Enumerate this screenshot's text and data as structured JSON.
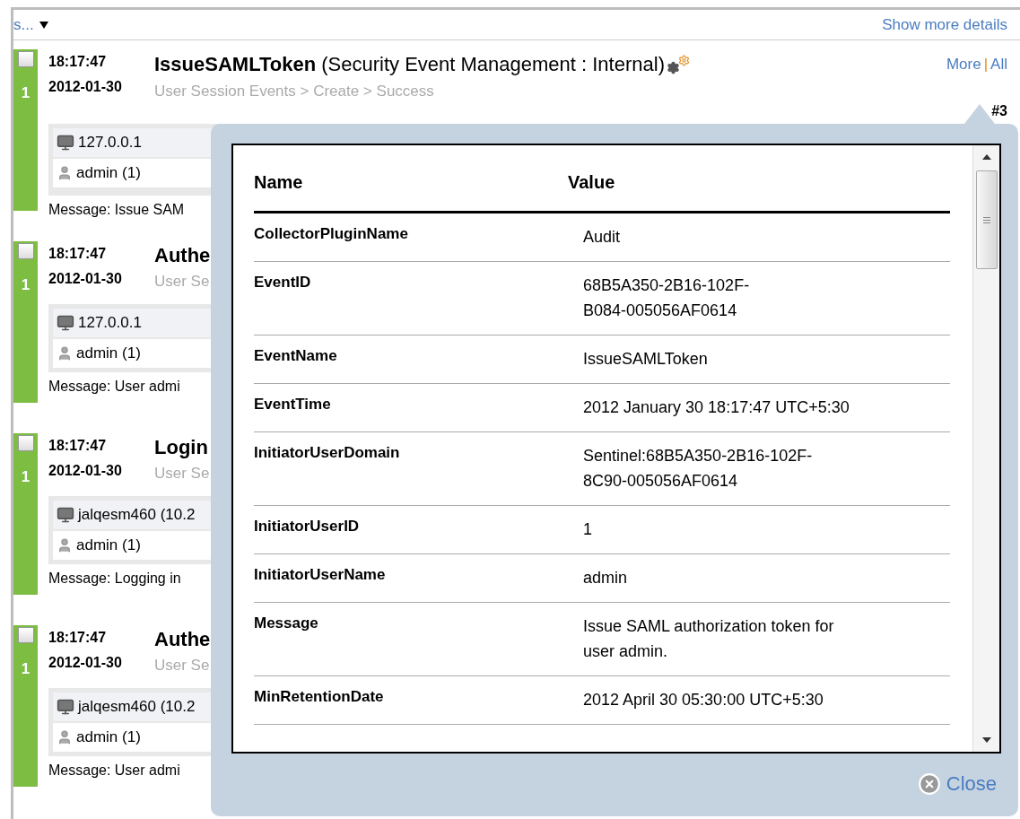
{
  "toolbar": {
    "filter_link": "s...",
    "show_more": "Show more details"
  },
  "events": [
    {
      "checked": false,
      "count": "1",
      "time": "18:17:47",
      "date": "2012-01-30",
      "title": "IssueSAMLToken",
      "source": "(Security Event Management : Internal)",
      "category": "User Session Events > Create > Success",
      "source_host": "127.0.0.1",
      "user": "admin (1)",
      "message": "Message: Issue SAM",
      "more": "More",
      "separator": "|",
      "all": "All",
      "number": "#3"
    },
    {
      "checked": false,
      "count": "1",
      "time": "18:17:47",
      "date": "2012-01-30",
      "title": "Authe",
      "category": "User Se",
      "source_host": "127.0.0.1",
      "user": "admin (1)",
      "message": "Message: User admi"
    },
    {
      "checked": false,
      "count": "1",
      "time": "18:17:47",
      "date": "2012-01-30",
      "title": "Login",
      "category": "User Se",
      "source_host": "jalqesm460 (10.2",
      "user": "admin (1)",
      "message": "Message: Logging in"
    },
    {
      "checked": false,
      "count": "1",
      "time": "18:17:47",
      "date": "2012-01-30",
      "title": "Authe",
      "category": "User Se",
      "source_host": "jalqesm460 (10.2",
      "user": "admin (1)",
      "message": "Message: User admi"
    }
  ],
  "details_popup": {
    "columns": [
      "Name",
      "Value"
    ],
    "rows": [
      {
        "name": "CollectorPluginName",
        "value": "Audit"
      },
      {
        "name": "EventID",
        "value": "68B5A350-2B16-102F-\nB084-005056AF0614"
      },
      {
        "name": "EventName",
        "value": "IssueSAMLToken"
      },
      {
        "name": "EventTime",
        "value": "2012 January 30 18:17:47 UTC+5:30"
      },
      {
        "name": "InitiatorUserDomain",
        "value": "Sentinel:68B5A350-2B16-102F-\n8C90-005056AF0614"
      },
      {
        "name": "InitiatorUserID",
        "value": "1"
      },
      {
        "name": "InitiatorUserName",
        "value": "admin"
      },
      {
        "name": "Message",
        "value": "Issue SAML authorization token for\nuser admin."
      },
      {
        "name": "MinRetentionDate",
        "value": "2012 April 30 05:30:00 UTC+5:30"
      }
    ],
    "close": "Close"
  }
}
